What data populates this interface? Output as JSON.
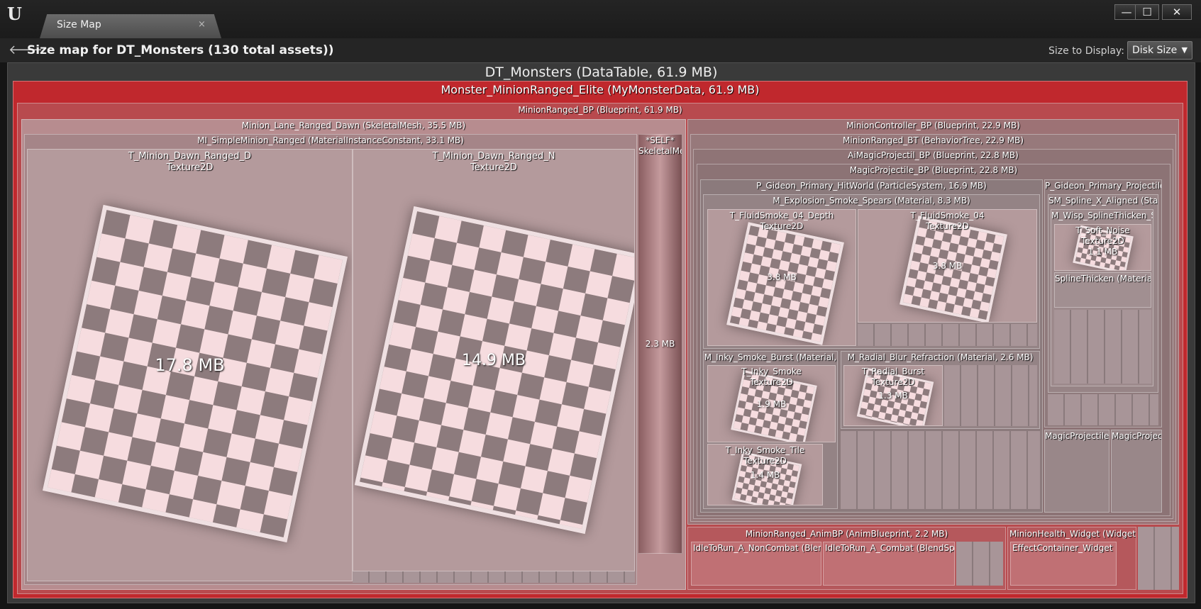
{
  "window": {
    "tab_label": "Size Map",
    "tab_close": "×",
    "minimize": "—",
    "maximize": "☐",
    "close": "✕"
  },
  "header": {
    "title": "Size map for DT_Monsters  (130 total assets))",
    "size_to_display_label": "Size to Display:",
    "size_to_display_value": "Disk Size"
  },
  "treemap": {
    "root": "DT_Monsters  (DataTable, 61.9 MB)",
    "elite": "Monster_MinionRanged_Elite  (MyMonsterData, 61.9 MB)",
    "blueprint": "MinionRanged_BP  (Blueprint, 61.9 MB)",
    "mesh": "Minion_Lane_Ranged_Dawn  (SkeletalMesh, 35.5 MB)",
    "mi": "MI_SimpleMinion_Ranged  (MaterialInstanceConstant, 33.1 MB)",
    "tex_d_name": "T_Minion_Dawn_Ranged_D",
    "tex_d_type": "Texture2D",
    "tex_d_size": "17.8 MB",
    "tex_n_name": "T_Minion_Dawn_Ranged_N",
    "tex_n_type": "Texture2D",
    "tex_n_size": "14.9 MB",
    "self_label": "*SELF*",
    "self_type": "SkeletalMe",
    "self_size": "2.3 MB",
    "controller": "MinionController_BP  (Blueprint, 22.9 MB)",
    "bt": "MinionRanged_BT  (BehaviorTree, 22.9 MB)",
    "ai_proj": "AiMagicProjectil_BP  (Blueprint, 22.8 MB)",
    "magic_proj": "MagicProjectile_BP  (Blueprint, 22.8 MB)",
    "hitworld": "P_Gideon_Primary_HitWorld  (ParticleSystem, 16.9 MB)",
    "explosion": "M_Explosion_Smoke_Spears  (Material, 8.3 MB)",
    "fluid_depth_name": "T_FluidSmoke_04_Depth",
    "fluid_depth_type": "Texture2D",
    "fluid_depth_size": "3.8 MB",
    "fluid_name": "T_FluidSmoke_04",
    "fluid_type": "Texture2D",
    "fluid_size": "3.8 MB",
    "inky_burst": "M_Inky_Smoke_Burst  (Material,",
    "inky_smoke_name": "T_Inky_Smoke",
    "inky_smoke_type": "Texture2D",
    "inky_smoke_size": "1.9 MB",
    "inky_tile_name": "T_Inky_Smoke_Tile",
    "inky_tile_type": "Texture2D",
    "inky_tile_size": "1.4 MB",
    "radial": "M_Radial_Blur_Refraction  (Material, 2.6 MB)",
    "radial_burst_name": "T_Radial_Burst",
    "radial_burst_type": "Texture2D",
    "radial_burst_size": "1.3 MB",
    "projectile": "P_Gideon_Primary_Projectile",
    "spline": "SM_Spline_X_Aligned  (Stat",
    "wisp": "M_Wisp_SplineThicken_S",
    "soft_noise_name": "T_Soft_Noise",
    "soft_noise_type": "Texture2D",
    "soft_noise_size": "1.1 MB",
    "spline_thicken": "SplineThicken  (Materia",
    "magic_projectile_a": "MagicProjectile",
    "magic_projectile_b": "MagicProjec",
    "animbp": "MinionRanged_AnimBP  (AnimBlueprint, 2.2 MB)",
    "idle_noncombat": "IdleToRun_A_NonCombat  (Blend",
    "idle_combat": "IdleToRun_A_Combat  (BlendSpa",
    "health_widget": "MinionHealth_Widget  (WidgetB",
    "effect_widget": "EffectContainer_Widget  (W"
  },
  "colors": {
    "accent_red": "#c0282d",
    "texture_tint": "#b49a9c"
  }
}
